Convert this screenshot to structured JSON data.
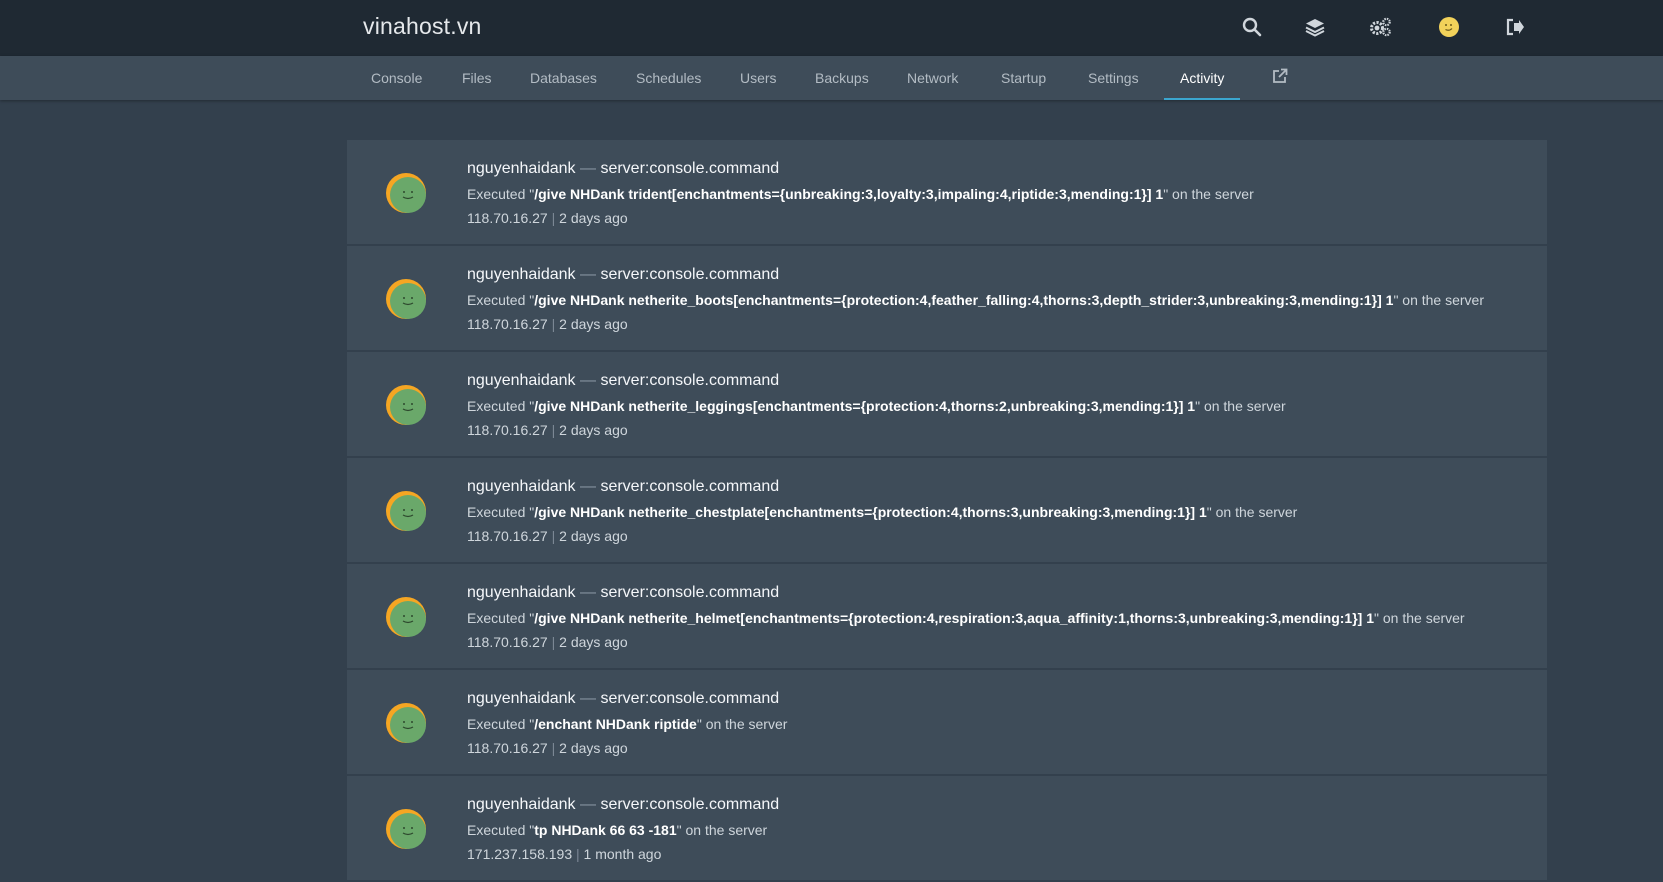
{
  "brand": "vinahost.vn",
  "top_icons": [
    "search-icon",
    "layers-icon",
    "cogs-icon",
    "user-avatar-icon",
    "sign-out-icon"
  ],
  "tabs": [
    {
      "label": "Console"
    },
    {
      "label": "Files"
    },
    {
      "label": "Databases"
    },
    {
      "label": "Schedules"
    },
    {
      "label": "Users"
    },
    {
      "label": "Backups"
    },
    {
      "label": "Network"
    },
    {
      "label": "Startup"
    },
    {
      "label": "Settings"
    },
    {
      "label": "Activity",
      "active": true
    }
  ],
  "colors": {
    "topbar": "#1f2933",
    "background": "#33404d",
    "card": "#3e4c59",
    "active_tab_underline": "#3ba6cf",
    "avatar_green": "#6aa86a",
    "avatar_orange": "#f5a623"
  },
  "activities": [
    {
      "user": "nguyenhaidank",
      "separator": "—",
      "event": "server:console.command",
      "prefix": "Executed \"",
      "command": "/give NHDank trident[enchantments={unbreaking:3,loyalty:3,impaling:4,riptide:3,mending:1}] 1",
      "suffix": "\" on the server",
      "ip": "118.70.16.27",
      "pipe": "|",
      "time": "2 days ago"
    },
    {
      "user": "nguyenhaidank",
      "separator": "—",
      "event": "server:console.command",
      "prefix": "Executed \"",
      "command": "/give NHDank netherite_boots[enchantments={protection:4,feather_falling:4,thorns:3,depth_strider:3,unbreaking:3,mending:1}] 1",
      "suffix": "\" on the server",
      "ip": "118.70.16.27",
      "pipe": "|",
      "time": "2 days ago"
    },
    {
      "user": "nguyenhaidank",
      "separator": "—",
      "event": "server:console.command",
      "prefix": "Executed \"",
      "command": "/give NHDank netherite_leggings[enchantments={protection:4,thorns:2,unbreaking:3,mending:1}] 1",
      "suffix": "\" on the server",
      "ip": "118.70.16.27",
      "pipe": "|",
      "time": "2 days ago"
    },
    {
      "user": "nguyenhaidank",
      "separator": "—",
      "event": "server:console.command",
      "prefix": "Executed \"",
      "command": "/give NHDank netherite_chestplate[enchantments={protection:4,thorns:3,unbreaking:3,mending:1}] 1",
      "suffix": "\" on the server",
      "ip": "118.70.16.27",
      "pipe": "|",
      "time": "2 days ago"
    },
    {
      "user": "nguyenhaidank",
      "separator": "—",
      "event": "server:console.command",
      "prefix": "Executed \"",
      "command": "/give NHDank netherite_helmet[enchantments={protection:4,respiration:3,aqua_affinity:1,thorns:3,unbreaking:3,mending:1}] 1",
      "suffix": "\" on the server",
      "ip": "118.70.16.27",
      "pipe": "|",
      "time": "2 days ago"
    },
    {
      "user": "nguyenhaidank",
      "separator": "—",
      "event": "server:console.command",
      "prefix": "Executed \"",
      "command": "/enchant NHDank riptide",
      "suffix": "\" on the server",
      "ip": "118.70.16.27",
      "pipe": "|",
      "time": "2 days ago"
    },
    {
      "user": "nguyenhaidank",
      "separator": "—",
      "event": "server:console.command",
      "prefix": "Executed \"",
      "command": "tp NHDank 66 63 -181",
      "suffix": "\" on the server",
      "ip": "171.237.158.193",
      "pipe": "|",
      "time": "1 month ago"
    }
  ]
}
